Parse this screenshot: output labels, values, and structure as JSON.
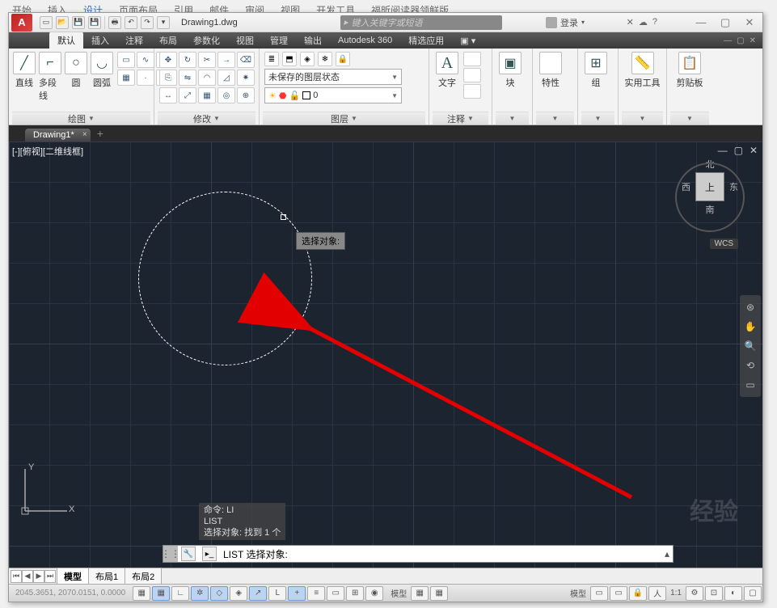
{
  "bg_tabs": [
    "开始",
    "插入",
    "设计",
    "页面布局",
    "引用",
    "邮件",
    "审阅",
    "视图",
    "开发工具",
    "福昕阅读器领鲜版"
  ],
  "bg_tabs_active_index": 2,
  "title": "Drawing1.dwg",
  "search_placeholder": "键入关键字或短语",
  "login_label": "登录",
  "menu_tabs": [
    "默认",
    "插入",
    "注释",
    "布局",
    "参数化",
    "视图",
    "管理",
    "输出",
    "Autodesk 360",
    "精选应用"
  ],
  "menu_active_index": 0,
  "ribbon": {
    "draw": {
      "title": "绘图",
      "items": [
        "直线",
        "多段线",
        "圆",
        "圆弧"
      ]
    },
    "modify": {
      "title": "修改"
    },
    "layer": {
      "title": "图层",
      "state_combo": "未保存的图层状态",
      "current_combo_value": "0"
    },
    "annotate": {
      "title": "注释",
      "text_btn": "文字"
    },
    "block": {
      "title": "块",
      "btn": "块"
    },
    "props": {
      "title": "特性",
      "btn": "特性"
    },
    "group": {
      "title": "组",
      "btn": "组"
    },
    "util": {
      "title": "实用工具",
      "btn": "实用工具"
    },
    "clip": {
      "title": "剪贴板",
      "btn": "剪贴板"
    }
  },
  "doc_tab": "Drawing1*",
  "viewport_label": "[-][俯视][二维线框]",
  "tooltip_text": "选择对象:",
  "viewcube": {
    "top": "北",
    "left": "西",
    "right": "东",
    "bottom": "南",
    "face": "上",
    "wcs": "WCS"
  },
  "ucs": {
    "y": "Y",
    "x": "X"
  },
  "cmd_history": [
    "命令: LI",
    "LIST",
    "选择对象: 找到 1 个"
  ],
  "cmd_prompt": "LIST 选择对象:",
  "layout_tabs": [
    "模型",
    "布局1",
    "布局2"
  ],
  "layout_active_index": 0,
  "status": {
    "coords": "2045.3651, 2070.0151, 0.0000",
    "model_label": "模型",
    "scale": "1:1",
    "model_label2": "模型"
  }
}
